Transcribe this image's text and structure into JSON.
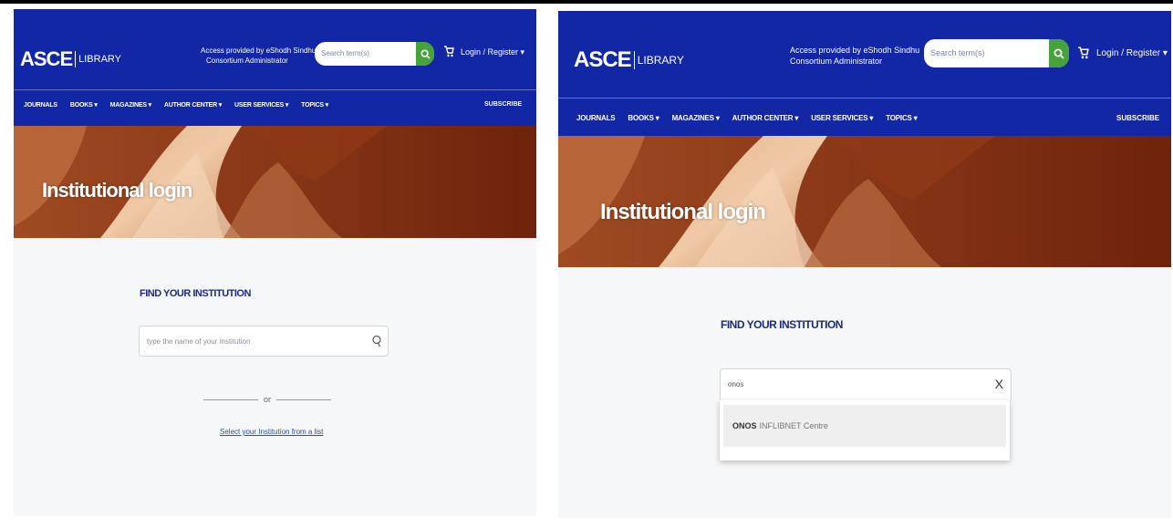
{
  "left": {
    "header": {
      "logo_main": "ASCE",
      "logo_sub": "LIBRARY",
      "access_line1": "Access provided by eShodh Sindhu",
      "access_line2": "Consortium Administrator",
      "search_placeholder": "Search term(s)",
      "login_label": "Login / Register ▾",
      "nav": [
        "JOURNALS",
        "BOOKS ▾",
        "MAGAZINES ▾",
        "AUTHOR CENTER ▾",
        "USER SERVICES ▾",
        "TOPICS ▾"
      ],
      "subscribe": "SUBSCRIBE"
    },
    "banner_title": "Institutional login",
    "find_title": "FIND YOUR INSTITUTION",
    "institution_placeholder": "type the name of your institution",
    "or_text": "or",
    "list_link": "Select your Institution from a list"
  },
  "right": {
    "header": {
      "logo_main": "ASCE",
      "logo_sub": "LIBRARY",
      "access_line1": "Access provided by eShodh Sindhu",
      "access_line2": "Consortium Administrator",
      "search_placeholder": "Search term(s)",
      "login_label": "Login / Register ▾",
      "nav": [
        "JOURNALS",
        "BOOKS ▾",
        "MAGAZINES ▾",
        "AUTHOR CENTER ▾",
        "USER SERVICES ▾",
        "TOPICS ▾"
      ],
      "subscribe": "SUBSCRIBE"
    },
    "banner_title": "Institutional login",
    "find_title": "FIND YOUR INSTITUTION",
    "institution_value": "onos",
    "clear_label": "X",
    "suggestion_bold": "ONOS",
    "suggestion_rest": "INFLIBNET Centre"
  },
  "colors": {
    "header_blue": "#1227a6",
    "search_green": "#46a23a",
    "title_navy": "#1c2a7e"
  },
  "icons": {
    "search": "search-icon",
    "cart": "cart-icon",
    "clear": "clear-icon"
  }
}
